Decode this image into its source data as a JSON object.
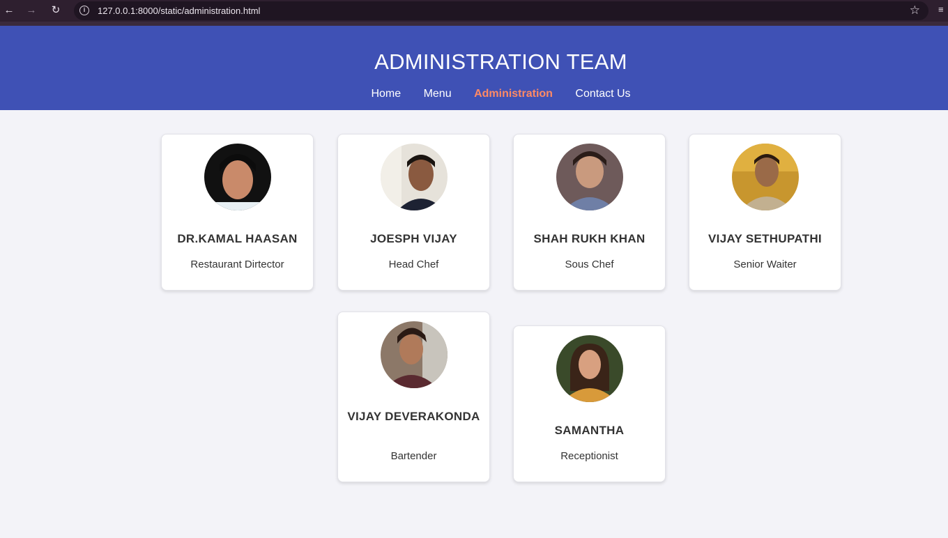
{
  "browser": {
    "url": "127.0.0.1:8000/static/administration.html"
  },
  "header": {
    "title": "ADMINISTRATION TEAM",
    "nav": [
      {
        "label": "Home",
        "active": false
      },
      {
        "label": "Menu",
        "active": false
      },
      {
        "label": "Administration",
        "active": true
      },
      {
        "label": "Contact Us",
        "active": false
      }
    ]
  },
  "colors": {
    "header_bg": "#3f51b5",
    "active_nav": "#ff8a65",
    "page_bg": "#f3f3f8"
  },
  "team": [
    {
      "name": "DR.KAMAL HAASAN",
      "role": "Restaurant Dirtector"
    },
    {
      "name": "JOESPH VIJAY",
      "role": "Head Chef"
    },
    {
      "name": "SHAH RUKH KHAN",
      "role": "Sous Chef"
    },
    {
      "name": "VIJAY SETHUPATHI",
      "role": "Senior Waiter"
    },
    {
      "name": "VIJAY DEVERAKONDA",
      "role": "Bartender"
    },
    {
      "name": "SAMANTHA",
      "role": "Receptionist"
    }
  ]
}
